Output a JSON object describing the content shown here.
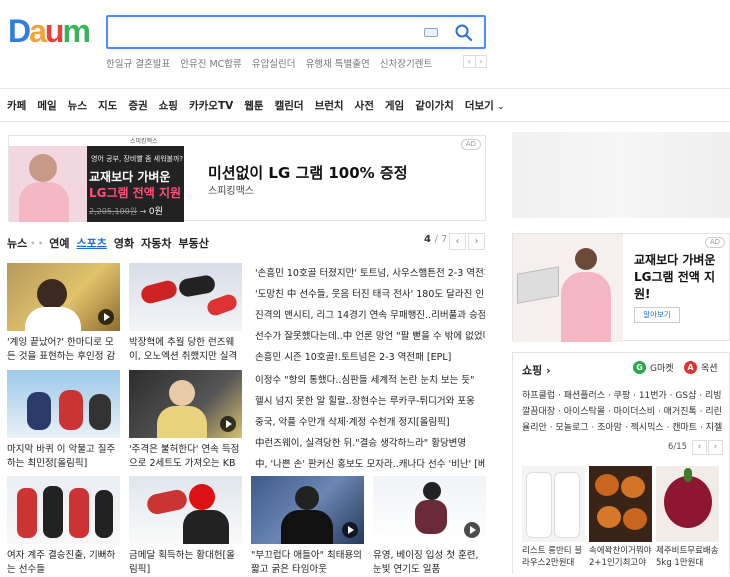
{
  "header": {
    "logo_letters": [
      "D",
      "a",
      "u",
      "m"
    ],
    "logo_colors": [
      "#2f7de1",
      "#f2a33a",
      "#e8423f",
      "#38b55b"
    ],
    "trends": [
      "한일규 결혼발표",
      "안유진 MC합류",
      "유압실린더",
      "유행재 특별출연",
      "신차장기렌트"
    ],
    "trend_prev": "‹",
    "trend_next": "›"
  },
  "nav": {
    "items": [
      "카페",
      "메일",
      "뉴스",
      "지도",
      "증권",
      "쇼핑",
      "카카오TV",
      "웹툰",
      "캘린더",
      "브런치",
      "사전",
      "게임",
      "같이가치",
      "더보기"
    ]
  },
  "ad_banner": {
    "brand_top": "스피킹맥스",
    "bubble": "영어 공부, 장비빨 좀 세워볼까?",
    "image_line1": "교재보다 가벼운",
    "image_line2": "LG그램 전액 지원",
    "old_price": "2,205,100원",
    "arrow": "→",
    "new_price": "0원",
    "headline": "미션없이 LG 그램 100% 증정",
    "sub": "스피킹맥스",
    "tag": "AD"
  },
  "news": {
    "tabs": [
      "뉴스",
      "연예",
      "스포츠",
      "영화",
      "자동차",
      "부동산"
    ],
    "active_tab": "스포츠",
    "dots": "• •",
    "page_current": "4",
    "page_total": "/ 7",
    "prev": "‹",
    "next": "›",
    "tiles": [
      {
        "caption": "'계잉 끝났어?' 한마디로 모든 것을 표현하는 후인정 감독"
      },
      {
        "caption": "박장혁에 추월 당한 런즈웨이, 오노엑션 취했지만 실격"
      },
      {
        "caption": "마지막 바퀴 이 악물고 질주하는 최민정[올림픽]"
      },
      {
        "caption": "'주격은 불허한다' 연속 득점으로 2세트도 가져오는 KB손보"
      },
      {
        "caption": "여자 계주 결승진출, 기뻐하는 선수들"
      },
      {
        "caption": "금메달 획득하는 황대헌[올림픽]"
      },
      {
        "caption": "\"부끄럽다 애들아\" 최태용의 짧고 굵은 타임아웃"
      },
      {
        "caption": "유영, 베이징 입성 첫 훈련, 눈빛 연기도 일품"
      }
    ],
    "headlines_a": [
      "'손흥민 10호골 터졌지만' 토트넘, 사우스햄튼전 2-3 역전패",
      "'도망친 中 선수들, 웃음 터진 태극 전사' 180도 달라진 인생",
      "진격의 맨시티, 리그 14경기 연속 무패행진..리버풀과 승점 9점 차",
      "선수가 잘못했다는데..中 언론 망언 \"팔 뻗을 수 밖에 없었다\"",
      "손흥민 시즌 10호골!.토트넘은 2-3 역전패 [EPL]"
    ],
    "headlines_b": [
      "이정수 \"항의 통했다..심판들 세계적 논란 눈치 보는 듯\"",
      "헬시 넘지 못한 알 힐랄..장현수는 루카쿠-튀디거와 포옹",
      "중국, 악플 수만개 삭제·계정 수천개 정지[올림픽]",
      "中런즈웨이, 실격당한 뒤.\"결승 생각하느라\" 황당변명",
      "中, '나쁜 손' 판커신 홍보도 모자라..캐나다 선수 '비난' [베이징 LIVE]"
    ]
  },
  "right": {
    "ad_text": "교재보다 가벼운 LG그램 전액 지원!",
    "ad_button": "알아보기",
    "ad_tag": "AD",
    "shop_title": "쇼핑 ›",
    "gmarket": "G마켓",
    "gmarket_badge": "G",
    "auction": "옥션",
    "auction_badge": "A",
    "shop_lines": [
      "하프클럽 · 패션플러스 · 쿠팡 · 11번가 · GS샵 · 리빙픽",
      "깔끔대장 · 아이스탁몰 · 마이더스비 · 매거진톡 · 리린",
      "율리안 · 모놀로그 · 조아맘 · 젝시믹스 · 캔마트 · 지젤"
    ],
    "shop_count": "6/15",
    "prev": "‹",
    "next": "›",
    "products": [
      {
        "name": "리스트 롱반티 블라우스2만원대"
      },
      {
        "name": "속에꽉찬이거뭐야 2+1인기최고야"
      },
      {
        "name": "제주비트무료배송 5kg 1만원대"
      }
    ]
  }
}
